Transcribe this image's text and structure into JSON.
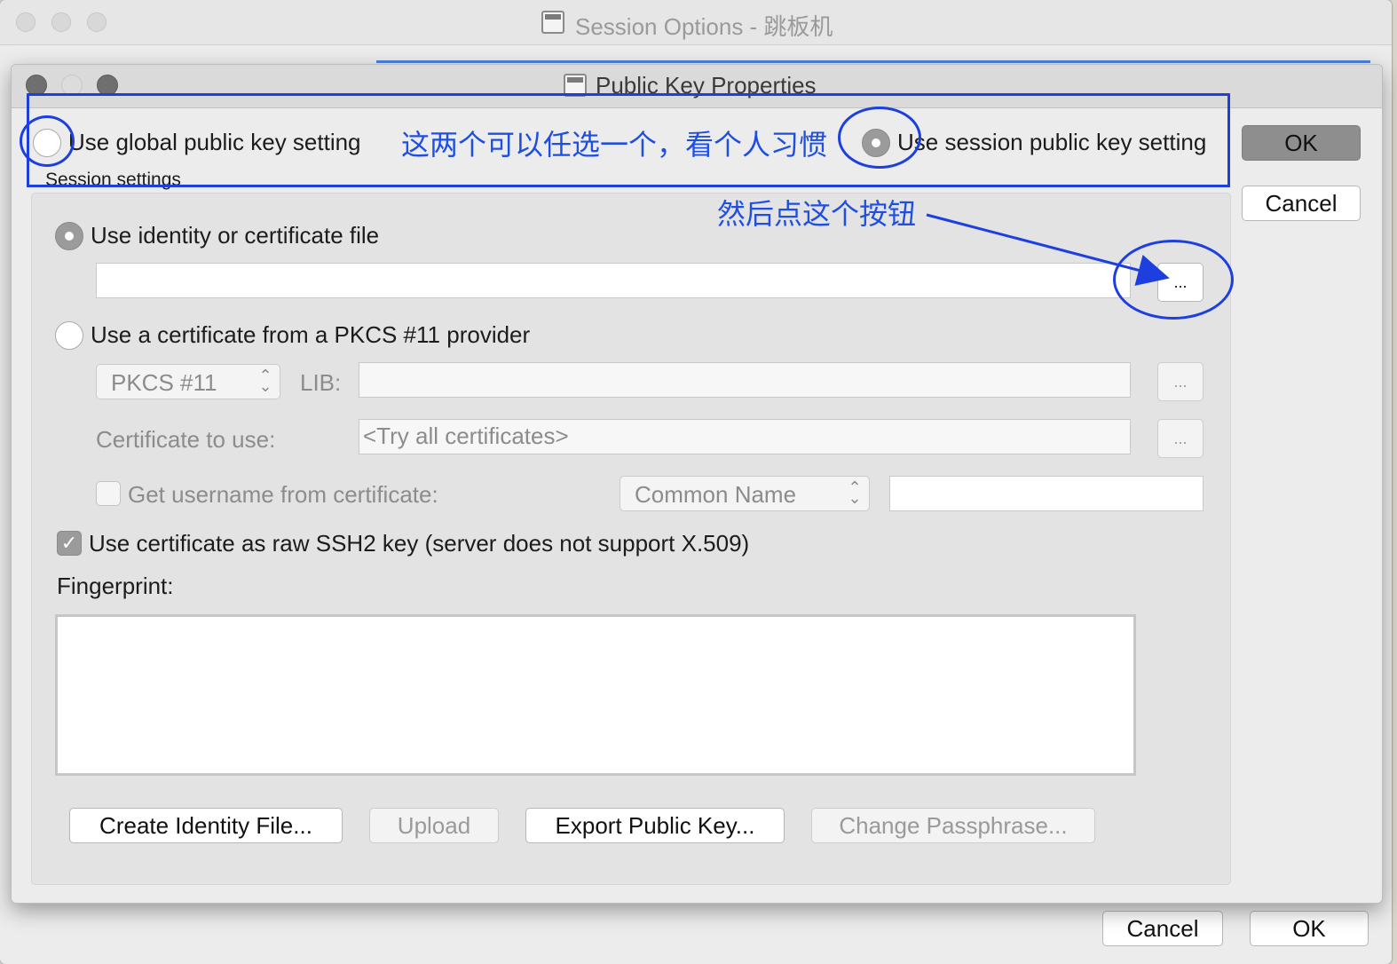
{
  "outer_window": {
    "title": "Session Options - 跳板机",
    "cancel_label": "Cancel",
    "ok_label": "OK"
  },
  "dialog": {
    "title": "Public Key Properties",
    "ok_label": "OK",
    "cancel_label": "Cancel",
    "use_global_label": "Use global public key setting",
    "use_global_selected": false,
    "use_session_label": "Use session public key setting",
    "use_session_selected": true,
    "session_settings_label": "Session settings",
    "identity": {
      "label": "Use identity or certificate file",
      "selected": true,
      "path_value": "",
      "browse_label": "..."
    },
    "pkcs11": {
      "label": "Use a certificate from a PKCS #11 provider",
      "selected": false,
      "provider_value": "PKCS #11",
      "lib_label": "LIB:",
      "lib_value": "",
      "lib_browse_label": "...",
      "cert_label": "Certificate to use:",
      "cert_value": "<Try all certificates>",
      "cert_browse_label": "...",
      "username_label": "Get username from certificate:",
      "username_checked": false,
      "name_field_value": "Common Name",
      "username_value": ""
    },
    "raw_ssh2": {
      "label": "Use certificate as raw SSH2 key (server does not support X.509)",
      "checked": true
    },
    "fingerprint_label": "Fingerprint:",
    "fingerprint_value": "",
    "buttons": {
      "create_identity": "Create Identity File...",
      "upload": "Upload",
      "export_public_key": "Export Public Key...",
      "change_passphrase": "Change Passphrase..."
    }
  },
  "annotations": {
    "choose_either": "这两个可以任选一个，看个人习惯",
    "then_click_button": "然后点这个按钮",
    "color": "#1d3fe0"
  },
  "colors": {
    "window_bg": "#ececec",
    "group_bg": "#e3e3e3",
    "default_button": "#8e8e8e"
  }
}
